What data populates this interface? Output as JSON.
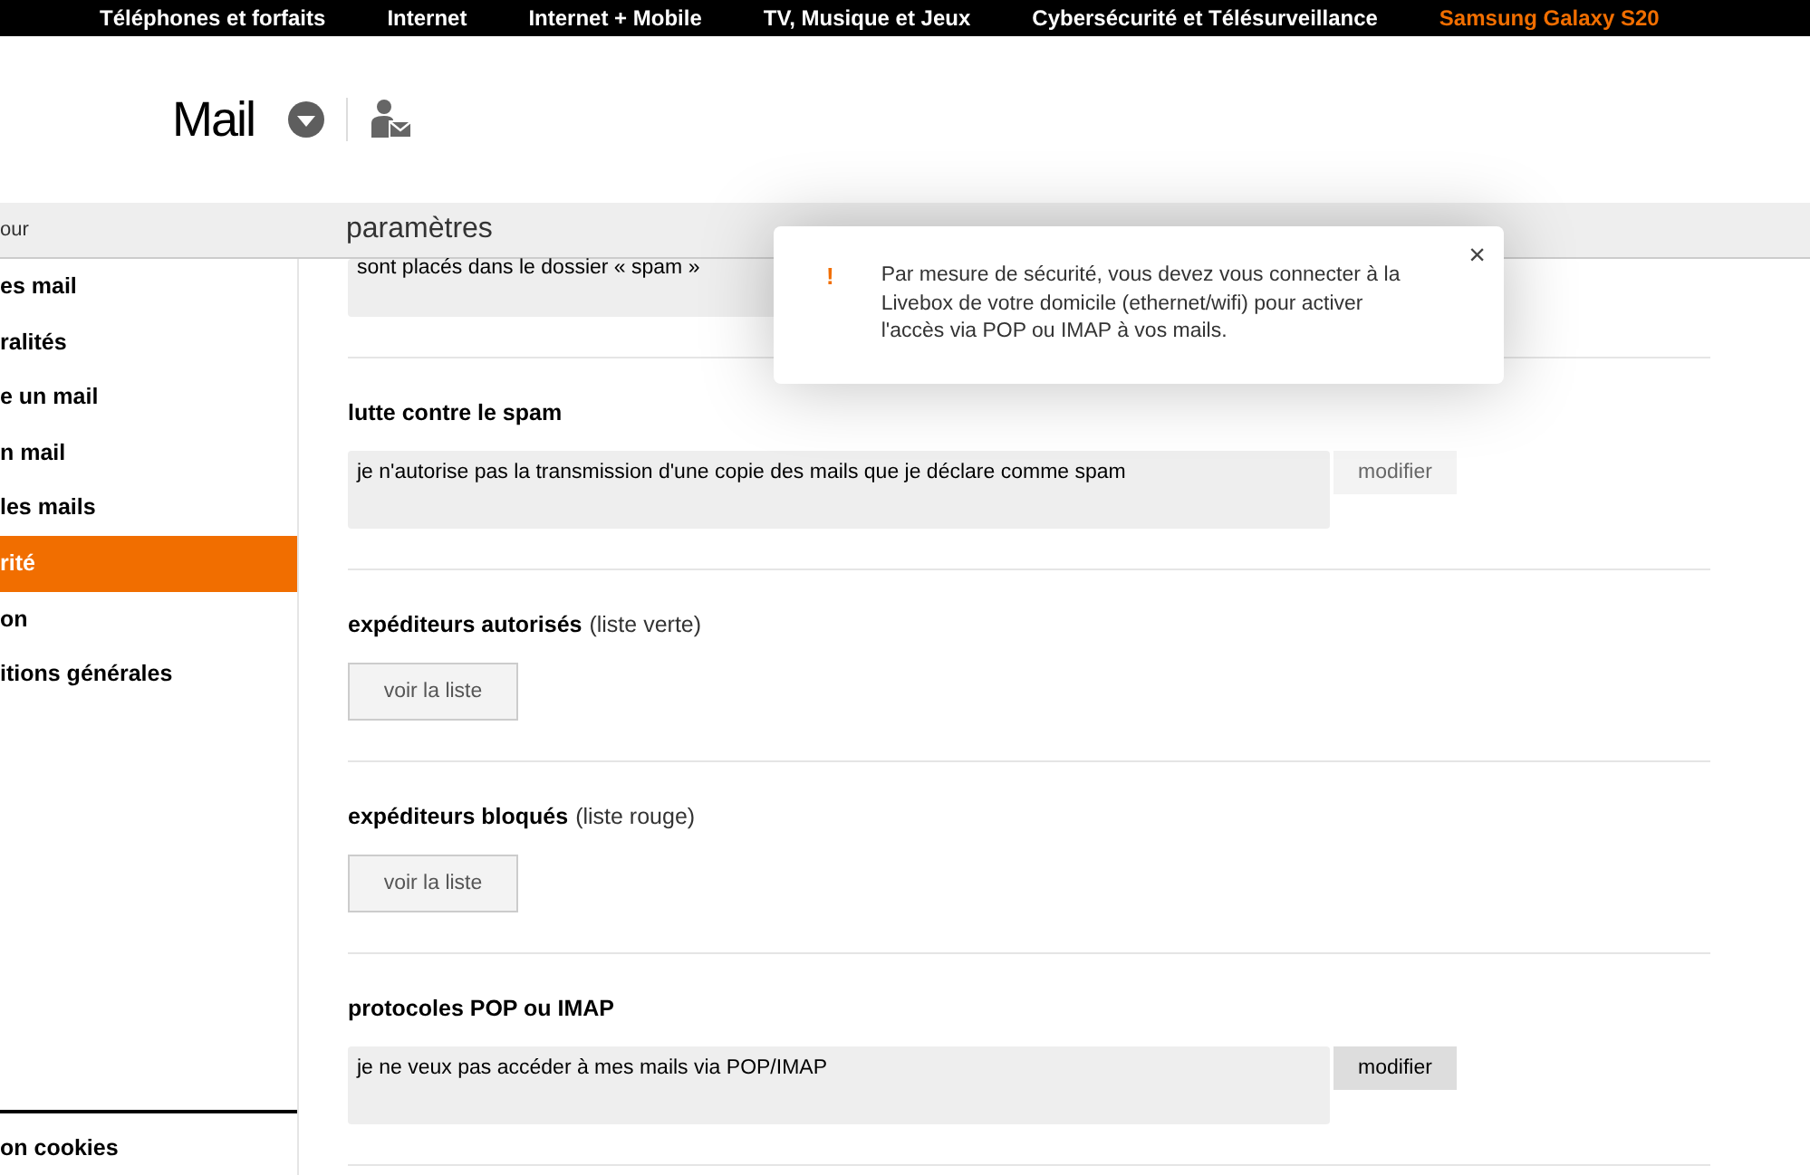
{
  "top_nav": [
    {
      "label": "Téléphones et forfaits",
      "selected": false
    },
    {
      "label": "Internet",
      "selected": false
    },
    {
      "label": "Internet + Mobile",
      "selected": false
    },
    {
      "label": "TV, Musique et Jeux",
      "selected": false
    },
    {
      "label": "Cybersécurité et Télésurveillance",
      "selected": false
    },
    {
      "label": "Samsung Galaxy S20",
      "selected": true
    }
  ],
  "header": {
    "title": "Mail"
  },
  "title_bar": {
    "back": "our",
    "title": "paramètres"
  },
  "sidebar": {
    "items": [
      {
        "label": "es mail",
        "selected": false
      },
      {
        "label": "ralités",
        "selected": false
      },
      {
        "label": "e un mail",
        "selected": false
      },
      {
        "label": "n mail",
        "selected": false
      },
      {
        "label": "les mails",
        "selected": false
      },
      {
        "label": "rité",
        "selected": true
      },
      {
        "label": "on",
        "selected": false
      },
      {
        "label": "itions générales",
        "selected": false
      }
    ],
    "footer": "on cookies"
  },
  "top_value": "sont placés dans le dossier « spam »",
  "sections": [
    {
      "kind": "setting",
      "title": "lutte contre le spam",
      "value": "je n'autorise pas la transmission d'une copie des mails que je déclare comme spam",
      "button": "modifier"
    },
    {
      "kind": "list",
      "title": "expéditeurs autorisés",
      "note": "(liste verte)",
      "button": "voir la liste"
    },
    {
      "kind": "list",
      "title": "expéditeurs bloqués",
      "note": "(liste rouge)",
      "button": "voir la liste"
    },
    {
      "kind": "setting",
      "title": "protocoles POP ou IMAP",
      "value": "je ne veux pas accéder à mes mails via POP/IMAP",
      "button": "modifier"
    }
  ],
  "alert": {
    "mark": "!",
    "message": "Par mesure de sécurité, vous devez vous connecter à la Livebox de votre domicile (ethernet/wifi) pour activer l'accès via POP ou IMAP à vos mails.",
    "close": "×"
  }
}
